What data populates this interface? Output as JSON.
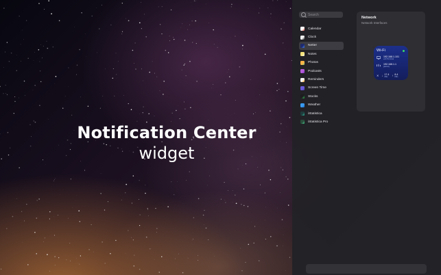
{
  "hero": {
    "title": "Notification Center",
    "subtitle": "widget"
  },
  "gallery": {
    "search_placeholder": "Search",
    "apps": [
      {
        "label": "Calendar",
        "icon": "calendar-icon",
        "color": "#ffffff",
        "accent": "#e94b3c",
        "selected": false
      },
      {
        "label": "Clock",
        "icon": "clock-icon",
        "color": "#f0f0f0",
        "accent": "#1c1c1e",
        "selected": false
      },
      {
        "label": "Netter",
        "icon": "netter-icon",
        "color": "#1e2a6e",
        "accent": "#4a8bff",
        "selected": true
      },
      {
        "label": "Notes",
        "icon": "notes-icon",
        "color": "#f5e27a",
        "accent": "#ffffff",
        "selected": false
      },
      {
        "label": "Photos",
        "icon": "photos-icon",
        "color": "#ffb347",
        "accent": "#7cd17c",
        "selected": false
      },
      {
        "label": "Podcasts",
        "icon": "podcasts-icon",
        "color": "#b45ddb",
        "accent": "#8a2fc7",
        "selected": false
      },
      {
        "label": "Reminders",
        "icon": "reminders-icon",
        "color": "#f2f2f2",
        "accent": "#ff9f0a",
        "selected": false
      },
      {
        "label": "Screen Time",
        "icon": "screen-time-icon",
        "color": "#6a5bd9",
        "accent": "#4b3fbf",
        "selected": false
      },
      {
        "label": "Stocks",
        "icon": "stocks-icon",
        "color": "#1c1c1e",
        "accent": "#34c759",
        "selected": false
      },
      {
        "label": "Weather",
        "icon": "weather-icon",
        "color": "#3a9bf0",
        "accent": "#1d6fd1",
        "selected": false
      },
      {
        "label": "iStatistica",
        "icon": "istatistica-icon",
        "color": "#1f3b3b",
        "accent": "#2fbfa0",
        "selected": false
      },
      {
        "label": "iStatistica Pro",
        "icon": "istatistica-pro-icon",
        "color": "#2a4a3a",
        "accent": "#48d597",
        "selected": false
      }
    ]
  },
  "preview": {
    "title": "Network",
    "subtitle": "Network Interfaces"
  },
  "widget": {
    "title": "Wi-Fi",
    "status_color": "#38d968",
    "rows": [
      {
        "icon": "monitor-icon",
        "ip": "192.168.1.101",
        "sub": "en0  IPv4  local"
      },
      {
        "icon": "router-icon",
        "ip": "192.168.1.1",
        "sub": "gateway"
      }
    ],
    "traffic": {
      "icon": "traffic-icon",
      "down_value": "17.4",
      "down_unit": "KB/s",
      "up_value": "8.4",
      "up_unit": "KB/s"
    }
  }
}
